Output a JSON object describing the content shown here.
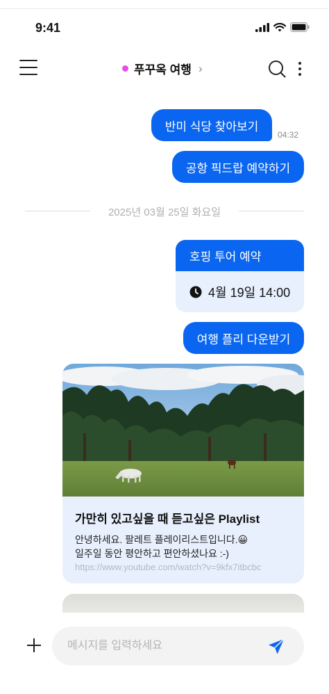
{
  "status": {
    "time": "9:41"
  },
  "header": {
    "title": "푸꾸옥 여행",
    "chevron": "›",
    "dot_color": "#e94ce6"
  },
  "colors": {
    "accent": "#0a66f0",
    "card_bg": "#e8f0fd"
  },
  "messages": {
    "m1": {
      "text": "반미 식당 찾아보기",
      "time": "04:32"
    },
    "m2": {
      "text": "공항 픽드랍 예약하기"
    },
    "date_divider": "2025년 03월 25일 화요일",
    "reservation": {
      "title": "호핑 투어 예약",
      "datetime": "4월 19일 14:00",
      "icon": "clock-icon"
    },
    "m3": {
      "text": "여행 플리 다운받기"
    },
    "link": {
      "title": "가만히 있고싶을 때 듣고싶은 Playlist",
      "line1": "안녕하세요. 팔레트 플레이리스트입니다.😀",
      "line2": "일주일 동안 평안하고 편안하셨나요 :-)",
      "url": "https://www.youtube.com/watch?v=9kfx7itbcbc"
    }
  },
  "composer": {
    "placeholder": "메시지를 입력하세요",
    "value": ""
  }
}
